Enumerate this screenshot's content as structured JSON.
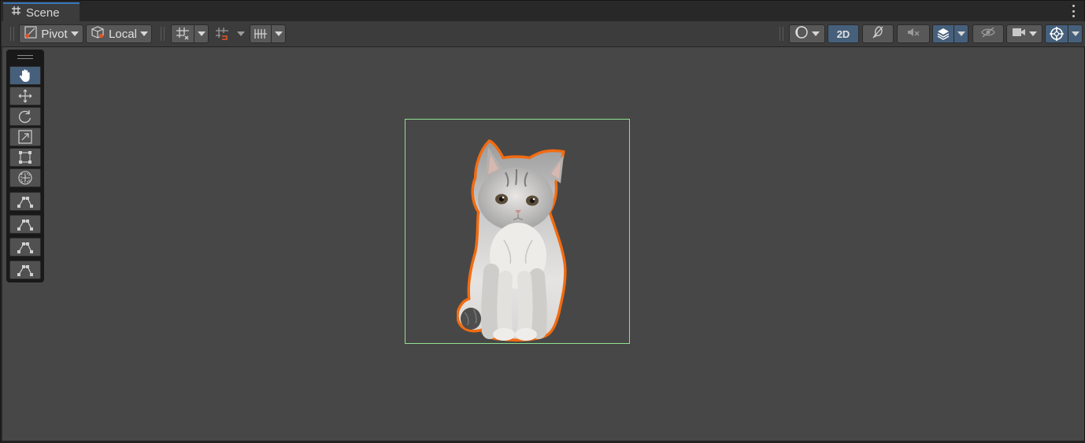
{
  "window": {
    "tab_title": "Scene",
    "tab_icon": "hash-grid-icon",
    "tab_menu_icon": "kebab-menu-icon"
  },
  "toolbar": {
    "pivot_label": "Pivot",
    "space_label": "Local",
    "mode_2d_label": "2D",
    "icons": [
      "pivot-icon",
      "local-space-icon",
      "grid-snap-icon",
      "increment-snap-icon",
      "grid-visibility-icon",
      "shading-mode-icon",
      "lighting-icon",
      "audio-icon",
      "effects-icon",
      "scene-visibility-icon",
      "camera-icon",
      "gizmos-icon"
    ]
  },
  "tools": {
    "active": "view-tool",
    "items": [
      {
        "name": "view-tool",
        "icon": "hand-icon"
      },
      {
        "name": "move-tool",
        "icon": "move-arrows-icon"
      },
      {
        "name": "rotate-tool",
        "icon": "rotate-icon"
      },
      {
        "name": "scale-tool",
        "icon": "scale-icon"
      },
      {
        "name": "rect-tool",
        "icon": "rect-icon"
      },
      {
        "name": "transform-tool",
        "icon": "transform-icon"
      },
      {
        "name": "custom-tool-1",
        "icon": "bone-tool-icon"
      },
      {
        "name": "custom-tool-2",
        "icon": "bone-tool-icon"
      },
      {
        "name": "custom-tool-3",
        "icon": "bone-tool-icon"
      },
      {
        "name": "custom-tool-4",
        "icon": "bone-tool-icon"
      }
    ]
  },
  "scene": {
    "selected_object": "kitten-sprite",
    "colors": {
      "viewport_bg": "#474747",
      "selection_bounds": "#8fe08f",
      "selection_outline": "#f26b10",
      "active_blue": "#46607c"
    }
  }
}
